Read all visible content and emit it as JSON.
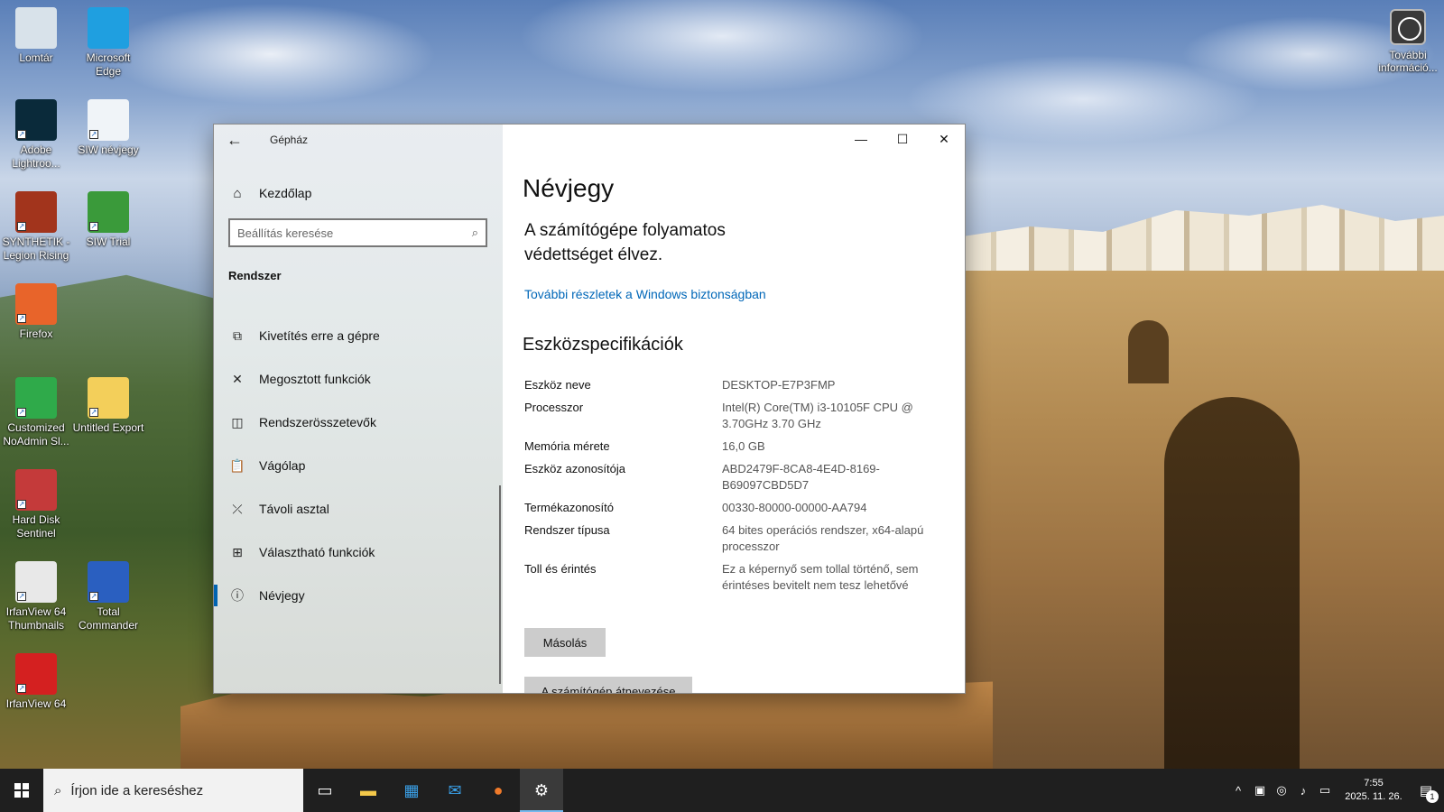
{
  "desktop": {
    "icons": [
      {
        "label": "Lomtár",
        "glyph": "recycle-bin-icon",
        "color": "#d8e2ea"
      },
      {
        "label": "Microsoft Edge",
        "glyph": "edge-icon",
        "color": "#1f9fe0"
      },
      {
        "label": "Adobe Lightroo...",
        "glyph": "lightroom-icon",
        "color": "#0a2a3a"
      },
      {
        "label": "SIW névjegy",
        "glyph": "siw-about-icon",
        "color": "#f0f4f8"
      },
      {
        "label": "SYNTHETIK - Legion Rising",
        "glyph": "synthetik-icon",
        "color": "#a2341c"
      },
      {
        "label": "SIW Trial",
        "glyph": "siw-trial-icon",
        "color": "#3a9a3a"
      },
      {
        "label": "Firefox",
        "glyph": "firefox-icon",
        "color": "#e8642a"
      },
      {
        "label": "Customized NoAdmin Sl...",
        "glyph": "noadmin-icon",
        "color": "#2faa4a"
      },
      {
        "label": "Untitled Export",
        "glyph": "folder-icon",
        "color": "#f3cf5a"
      },
      {
        "label": "Hard Disk Sentinel",
        "glyph": "hard-disk-sentinel-icon",
        "color": "#c43a3a"
      },
      {
        "label": "IrfanView 64 Thumbnails",
        "glyph": "irfanview-thumbnails-icon",
        "color": "#e8e8e8"
      },
      {
        "label": "Total Commander",
        "glyph": "total-commander-icon",
        "color": "#2a5fc0"
      },
      {
        "label": "IrfanView 64",
        "glyph": "irfanview-icon",
        "color": "#d42020"
      }
    ],
    "info_icon_label": "További információ..."
  },
  "window": {
    "app_title": "Gépház",
    "back_glyph": "←",
    "caption": {
      "minimize": "—",
      "maximize": "☐",
      "close": "✕"
    },
    "sidebar": {
      "home_label": "Kezdőlap",
      "search_placeholder": "Beállítás keresése",
      "section": "Rendszer",
      "items": [
        {
          "label": "Kivetítés erre a gépre",
          "icon": "projecting-icon",
          "glyph": "⧉"
        },
        {
          "label": "Megosztott funkciók",
          "icon": "shared-experiences-icon",
          "glyph": "✕"
        },
        {
          "label": "Rendszerösszetevők",
          "icon": "system-components-icon",
          "glyph": "◫"
        },
        {
          "label": "Vágólap",
          "icon": "clipboard-icon",
          "glyph": "📋"
        },
        {
          "label": "Távoli asztal",
          "icon": "remote-desktop-icon",
          "glyph": "⤫"
        },
        {
          "label": "Választható funkciók",
          "icon": "optional-features-icon",
          "glyph": "⊞"
        },
        {
          "label": "Névjegy",
          "icon": "about-icon",
          "glyph": "ⓘ",
          "active": true
        }
      ]
    },
    "content": {
      "title": "Névjegy",
      "protection_text": "A számítógépe folyamatos védettséget élvez.",
      "security_link": "További részletek a Windows biztonságban",
      "specs_title": "Eszközspecifikációk",
      "specs": [
        {
          "key": "Eszköz neve",
          "value": "DESKTOP-E7P3FMP"
        },
        {
          "key": "Processzor",
          "value": "Intel(R) Core(TM) i3-10105F CPU @ 3.70GHz   3.70 GHz"
        },
        {
          "key": "Memória mérete",
          "value": "16,0 GB"
        },
        {
          "key": "Eszköz azonosítója",
          "value": "ABD2479F-8CA8-4E4D-8169-B69097CBD5D7"
        },
        {
          "key": "Termékazonosító",
          "value": "00330-80000-00000-AA794"
        },
        {
          "key": "Rendszer típusa",
          "value": "64 bites operációs rendszer, x64-alapú processzor"
        },
        {
          "key": "Toll és érintés",
          "value": "Ez a képernyő sem tollal történő, sem érintéses bevitelt nem tesz lehetővé"
        }
      ],
      "copy_button": "Másolás",
      "rename_button": "A számítógép átnevezése"
    }
  },
  "taskbar": {
    "search_placeholder": "Írjon ide a kereséshez",
    "clock_time": "7:55",
    "clock_date": "2025. 11. 26.",
    "notification_count": "1",
    "accent": "#76b9ed"
  }
}
